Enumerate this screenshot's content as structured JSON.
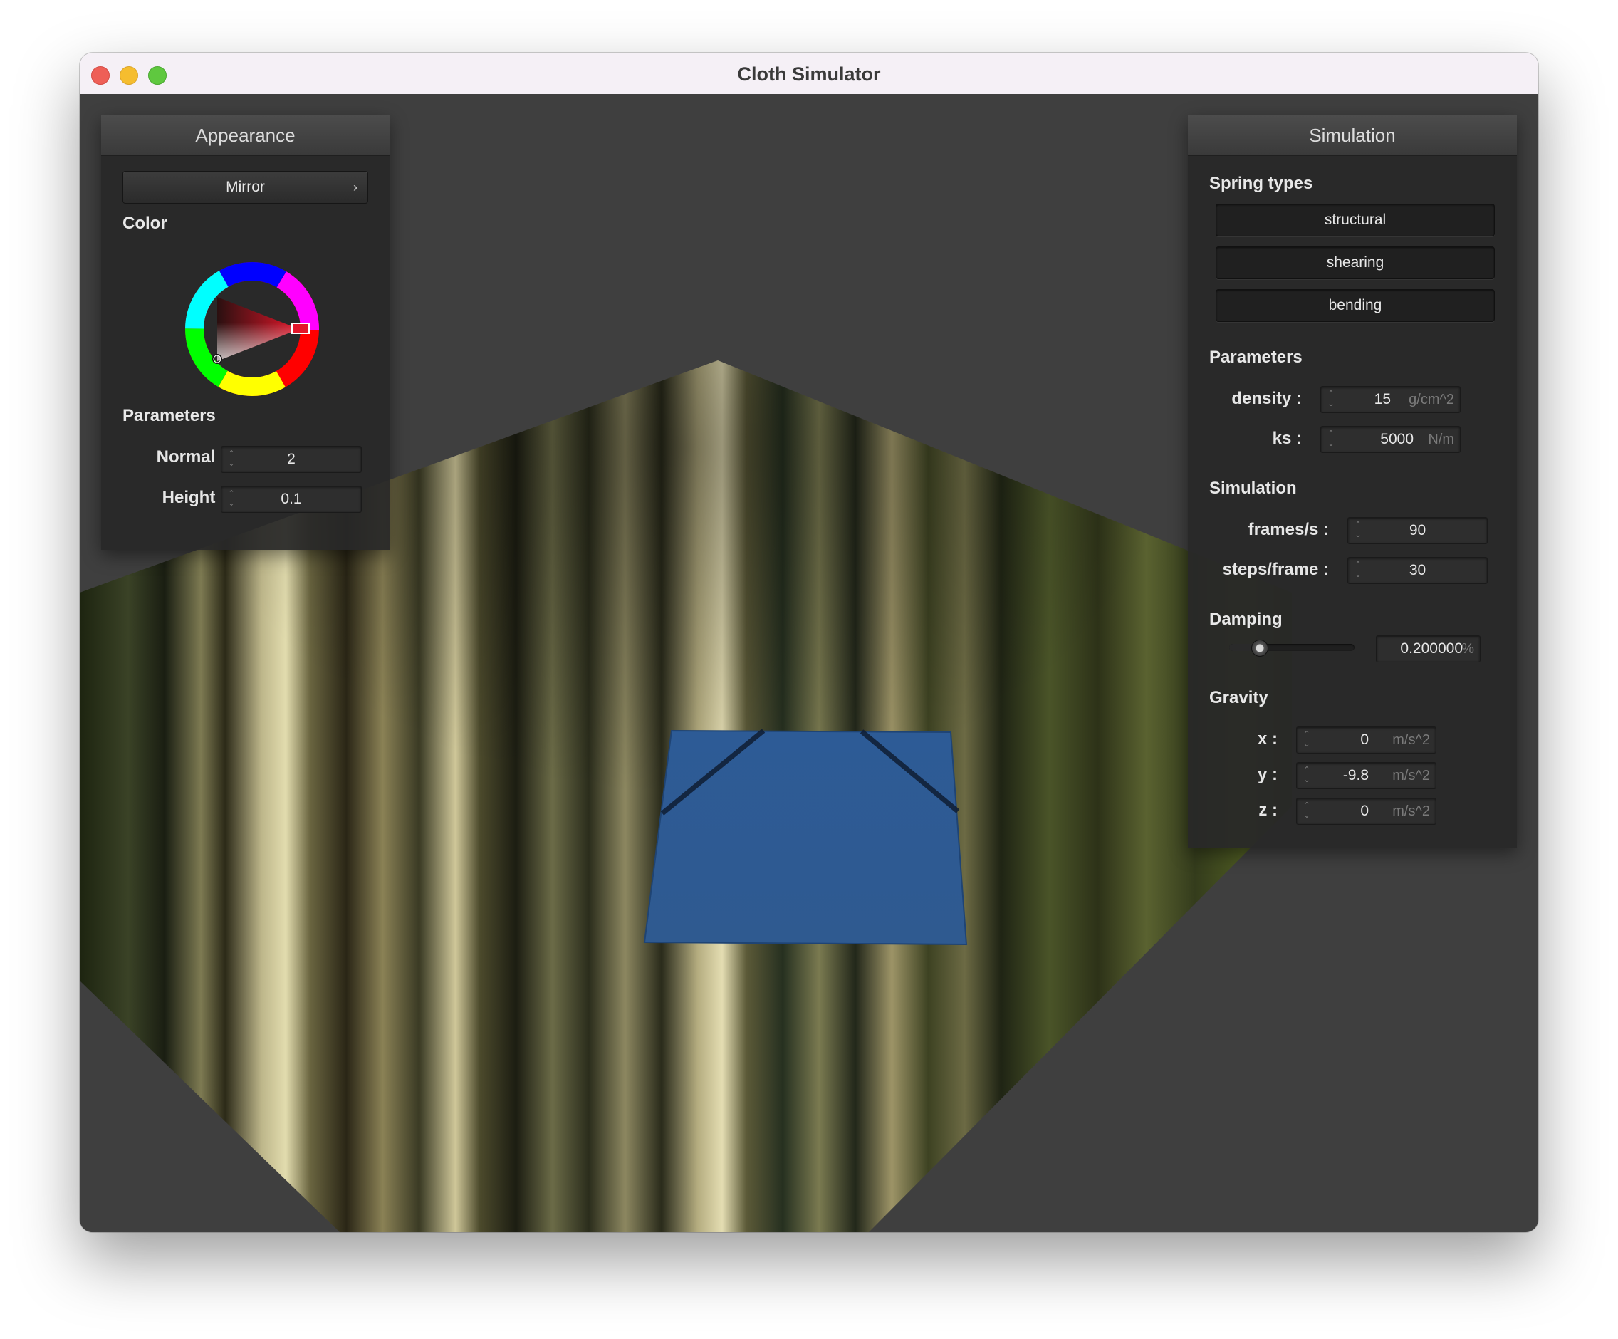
{
  "window": {
    "title": "Cloth Simulator"
  },
  "appearance": {
    "header": "Appearance",
    "shader_button": "Mirror",
    "color_label": "Color",
    "params_label": "Parameters",
    "normal": {
      "label": "Normal :",
      "value": "2"
    },
    "height": {
      "label": "Height :",
      "value": "0.1"
    }
  },
  "simulation": {
    "header": "Simulation",
    "spring_label": "Spring types",
    "springs": [
      "structural",
      "shearing",
      "bending"
    ],
    "params_label": "Parameters",
    "density": {
      "label": "density :",
      "value": "15",
      "unit": "g/cm^2"
    },
    "ks": {
      "label": "ks :",
      "value": "5000",
      "unit": "N/m"
    },
    "sim_label": "Simulation",
    "fps": {
      "label": "frames/s :",
      "value": "90"
    },
    "steps": {
      "label": "steps/frame :",
      "value": "30"
    },
    "damping_label": "Damping",
    "damping": {
      "value": "0.200000",
      "unit": "%",
      "slider_fraction": 0.2
    },
    "gravity_label": "Gravity",
    "gx": {
      "label": "x :",
      "value": "0",
      "unit": "m/s^2"
    },
    "gy": {
      "label": "y :",
      "value": "-9.8",
      "unit": "m/s^2"
    },
    "gz": {
      "label": "z :",
      "value": "0",
      "unit": "m/s^2"
    }
  },
  "icons": {
    "spinner": "up-down-arrows-icon",
    "chevron": "chevron-right-icon"
  },
  "colors": {
    "cloth": "#2f5d97",
    "panel_bg": "#282828",
    "accent": "#d9293a"
  }
}
